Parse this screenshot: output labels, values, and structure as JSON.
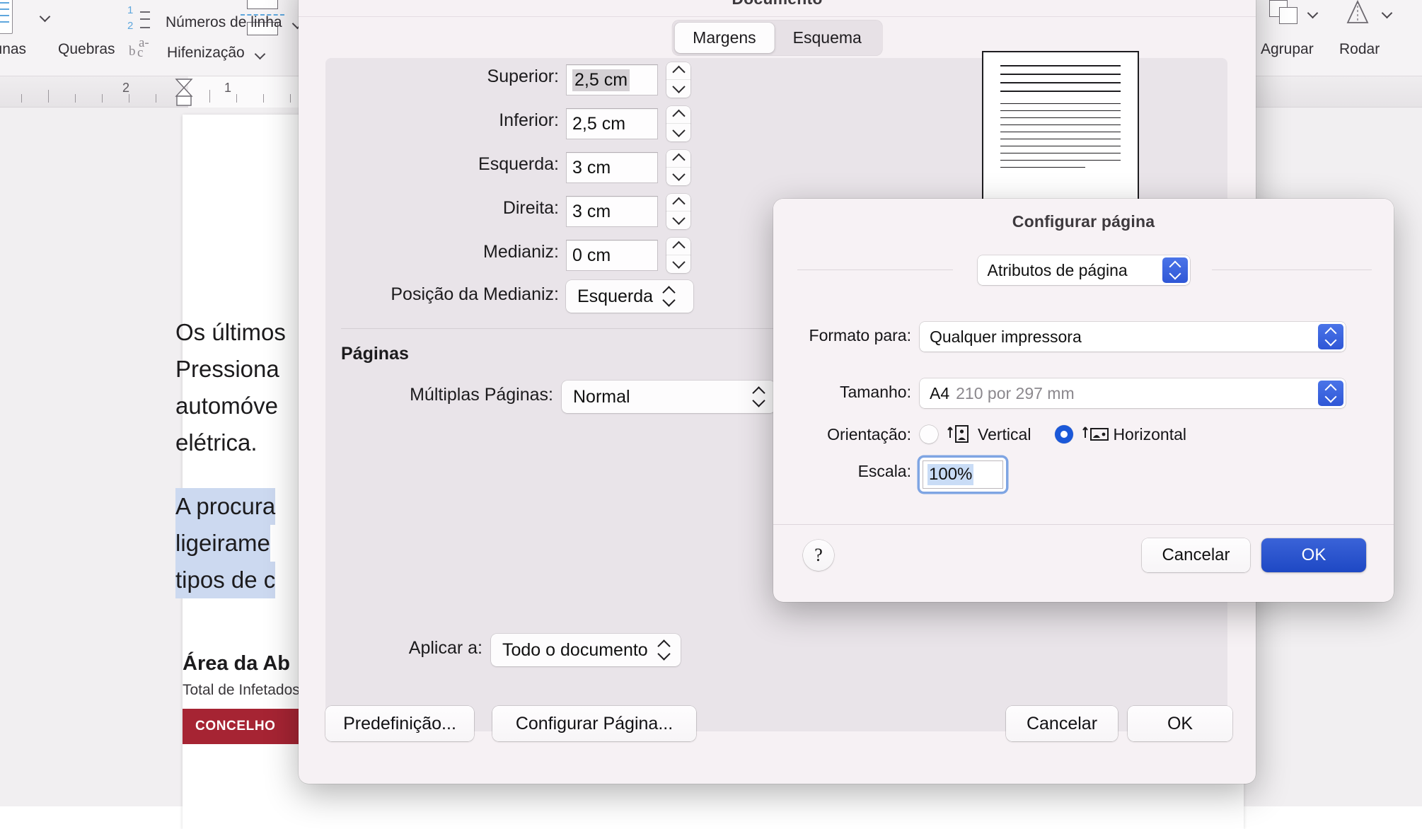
{
  "ribbon": {
    "items": [
      {
        "label": "Colunas",
        "icon": "columns-icon"
      },
      {
        "label": "Quebras",
        "icon": "page-break-icon"
      },
      {
        "label": "Números de linha",
        "icon": "line-numbers-icon"
      },
      {
        "label": "Hifenização",
        "icon": "hyphenation-icon"
      },
      {
        "label": "Agrupar",
        "icon": "group-objects-icon"
      },
      {
        "label": "Rodar",
        "icon": "rotate-object-icon"
      }
    ]
  },
  "ruler": {
    "numbers_left": [
      "2",
      "1"
    ],
    "numbers_right": [
      "1"
    ]
  },
  "document": {
    "paragraphs": [
      "Os últimos",
      "Pressiona",
      "automóve",
      "elétrica."
    ],
    "highlighted": [
      "A procura",
      "ligeirame",
      "tipos de c"
    ],
    "heading": "Área da Ab",
    "subheading": "Total de Infetados",
    "table_header": "CONCELHO"
  },
  "documento_dialog": {
    "title": "Documento",
    "tabs": [
      {
        "label": "Margens",
        "active": true
      },
      {
        "label": "Esquema",
        "active": false
      }
    ],
    "margins": [
      {
        "label": "Superior:",
        "value": "2,5 cm",
        "selected": true
      },
      {
        "label": "Inferior:",
        "value": "2,5 cm",
        "selected": false
      },
      {
        "label": "Esquerda:",
        "value": "3 cm",
        "selected": false
      },
      {
        "label": "Direita:",
        "value": "3 cm",
        "selected": false
      },
      {
        "label": "Medianiz:",
        "value": "0 cm",
        "selected": false
      }
    ],
    "gutter_position": {
      "label": "Posição da Medianiz:",
      "value": "Esquerda"
    },
    "pages_section": {
      "title": "Páginas",
      "multiple_pages": {
        "label": "Múltiplas Páginas:",
        "value": "Normal"
      }
    },
    "apply_to": {
      "label": "Aplicar a:",
      "value": "Todo o documento"
    },
    "footer_buttons": [
      {
        "label": "Predefinição...",
        "name": "default-button"
      },
      {
        "label": "Configurar Página...",
        "name": "page-setup-button"
      },
      {
        "label": "Cancelar",
        "name": "cancel-button"
      },
      {
        "label": "OK",
        "name": "ok-button"
      }
    ]
  },
  "configurar_pagina_dialog": {
    "title": "Configurar página",
    "settings_popup": {
      "value": "Atributos de página"
    },
    "format_for": {
      "label": "Formato para:",
      "value": "Qualquer impressora"
    },
    "paper_size": {
      "label": "Tamanho:",
      "value_bold": "A4",
      "value_dim": "210 por 297 mm"
    },
    "orientation": {
      "label": "Orientação:",
      "options": [
        {
          "label": "Vertical",
          "selected": false,
          "icon": "portrait-icon"
        },
        {
          "label": "Horizontal",
          "selected": true,
          "icon": "landscape-icon"
        }
      ]
    },
    "scale": {
      "label": "Escala:",
      "value": "100%",
      "selected": true
    },
    "help_label": "?",
    "buttons": [
      {
        "label": "Cancelar",
        "style": "plain",
        "name": "cancel-button"
      },
      {
        "label": "OK",
        "style": "primary",
        "name": "ok-button"
      }
    ]
  },
  "colors": {
    "accent_blue": "#1e48c4",
    "chevron_blue": "#2f57d6",
    "selection_blue": "#c9dcf6",
    "table_red": "#a62433",
    "highlight_lavender": "#ccd9f0"
  }
}
